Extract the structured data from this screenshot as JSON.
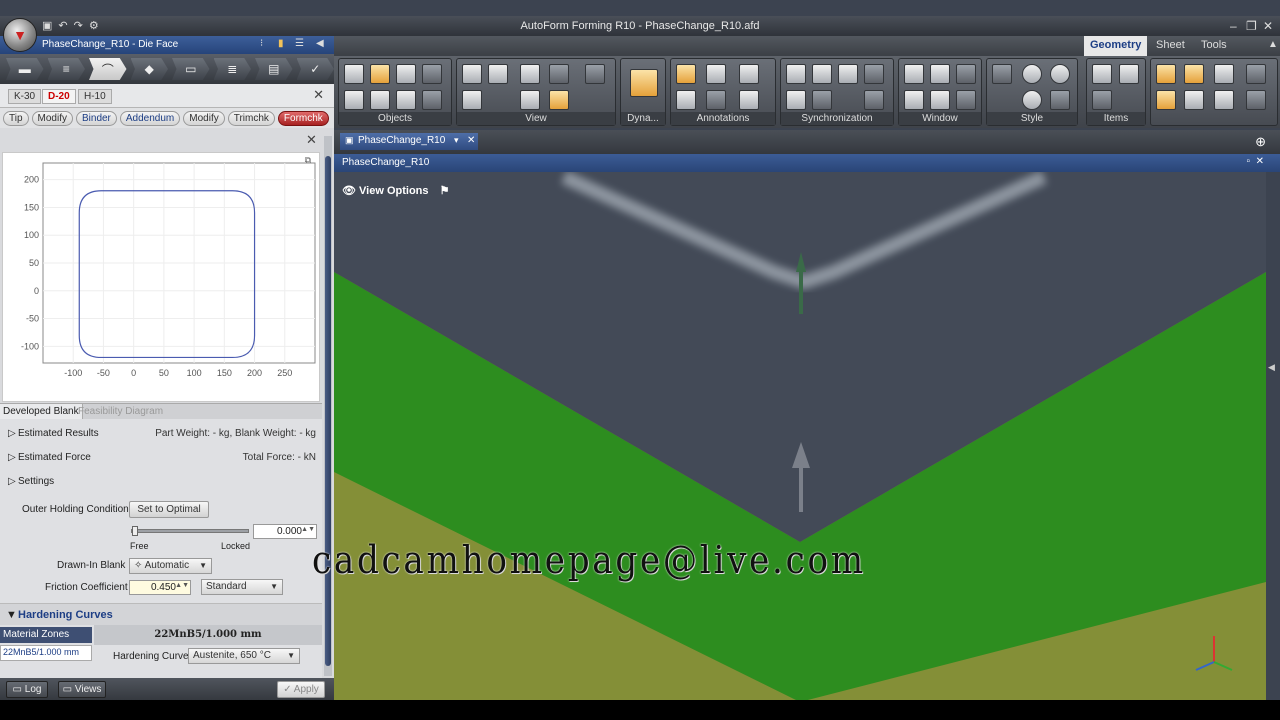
{
  "window": {
    "title": "AutoForm Forming R10 - PhaseChange_R10.afd",
    "logo": "autoform-logo"
  },
  "doc": {
    "name": "PhaseChange_R10",
    "step": "Die Face"
  },
  "process_steps": [
    "blank-icon",
    "drawing-icon",
    "die-face-icon",
    "addendum-icon",
    "trim-icon",
    "flange-icon",
    "nc-icon",
    "check-icon"
  ],
  "tabs1": [
    {
      "label": "K-30"
    },
    {
      "label": "D-20"
    },
    {
      "label": "H-10"
    }
  ],
  "tabs2": [
    {
      "label": "Tip"
    },
    {
      "label": "Modify"
    },
    {
      "label": "Binder"
    },
    {
      "label": "Addendum"
    },
    {
      "label": "Modify"
    },
    {
      "label": "Trimchk"
    },
    {
      "label": "Formchk"
    }
  ],
  "chart_data": {
    "type": "line",
    "title": "",
    "xticks": [
      "-100",
      "-50",
      "0",
      "50",
      "100",
      "150",
      "200",
      "250"
    ],
    "yticks": [
      "200",
      "150",
      "100",
      "50",
      "0",
      "-50",
      "-100"
    ],
    "xlim": [
      -150,
      300
    ],
    "ylim": [
      -130,
      230
    ],
    "series": [
      {
        "points": [
          [
            -60,
            180
          ],
          [
            170,
            180
          ],
          [
            200,
            150
          ],
          [
            200,
            -90
          ],
          [
            170,
            -120
          ],
          [
            -60,
            -120
          ],
          [
            -90,
            -90
          ],
          [
            -90,
            150
          ]
        ]
      }
    ]
  },
  "devtabs": {
    "active": "Developed Blank",
    "inactive": "Feasibility Diagram"
  },
  "estimated_results": {
    "label": "Estimated Results",
    "value": "Part Weight: - kg, Blank Weight: - kg"
  },
  "estimated_force": {
    "label": "Estimated Force",
    "value": "Total Force: - kN"
  },
  "settings": {
    "label": "Settings"
  },
  "outer": {
    "label": "Outer Holding Condition",
    "button": "Set to Optimal",
    "value": "0.000",
    "slider": 0.0,
    "free": "Free",
    "locked": "Locked"
  },
  "drawn_in": {
    "label": "Drawn-In Blank",
    "value": "Automatic"
  },
  "friction": {
    "label": "Friction Coefficient",
    "value": "0.450",
    "mode": "Standard"
  },
  "hardening": {
    "label": "Hardening Curves",
    "zones_label": "Material Zones",
    "zone": "22MnB5/1.000 mm",
    "header": "22MnB5/1.000 mm",
    "curve_label": "Hardening Curve",
    "curve": "Austenite, 650 °C"
  },
  "bottom": {
    "log": "Log",
    "views": "Views",
    "apply": "Apply"
  },
  "ribbon": {
    "tabs": [
      "Geometry",
      "Sheet",
      "Tools"
    ],
    "groups": [
      "Objects",
      "View",
      "Dyna...",
      "Annotations",
      "Synchronization",
      "Window",
      "Style",
      "Items"
    ]
  },
  "viewport": {
    "tab": "PhaseChange_R10",
    "header": "PhaseChange_R10",
    "view_options": "View Options"
  },
  "watermark": "cadcamhomepage@live.com"
}
